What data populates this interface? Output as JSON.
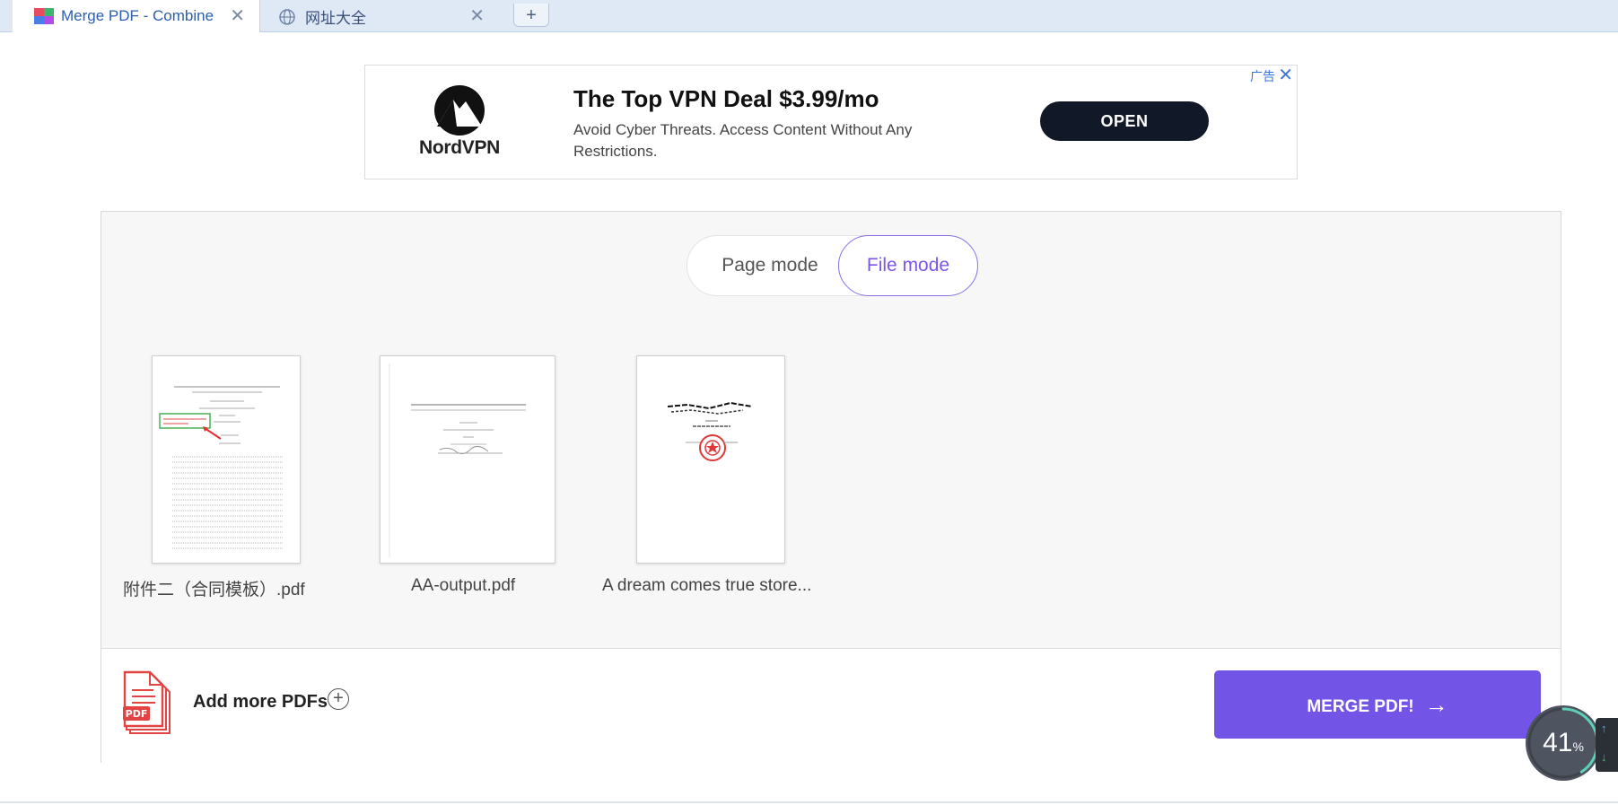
{
  "browser": {
    "tabs": [
      {
        "title": "Merge PDF - Combine",
        "active": true
      },
      {
        "title": "网址大全",
        "active": false
      }
    ],
    "new_tab_label": "+",
    "close_glyph": "✕"
  },
  "ad": {
    "brand": "NordVPN",
    "headline": "The Top VPN Deal $3.99/mo",
    "description": "Avoid Cyber Threats. Access Content Without Any Restrictions.",
    "cta": "OPEN",
    "ad_label": "广告",
    "close_glyph": "✕"
  },
  "mode_toggle": {
    "page_mode": "Page mode",
    "file_mode": "File mode",
    "selected": "File mode"
  },
  "files": [
    {
      "name": "附件二（合同模板）.pdf"
    },
    {
      "name": "AA-output.pdf"
    },
    {
      "name": "A dream comes true store..."
    }
  ],
  "bottom": {
    "pdf_icon_label": "PDF",
    "add_more": "Add more PDFs",
    "add_plus": "+",
    "merge_label": "MERGE PDF!",
    "merge_arrow": "→"
  },
  "progress_widget": {
    "value": "41",
    "unit": "%",
    "fraction": 0.41
  },
  "colors": {
    "accent": "#7254e6",
    "toggle_selected": "#7a57e8",
    "ad_button": "#111827",
    "tab_text": "#2b5fae"
  }
}
